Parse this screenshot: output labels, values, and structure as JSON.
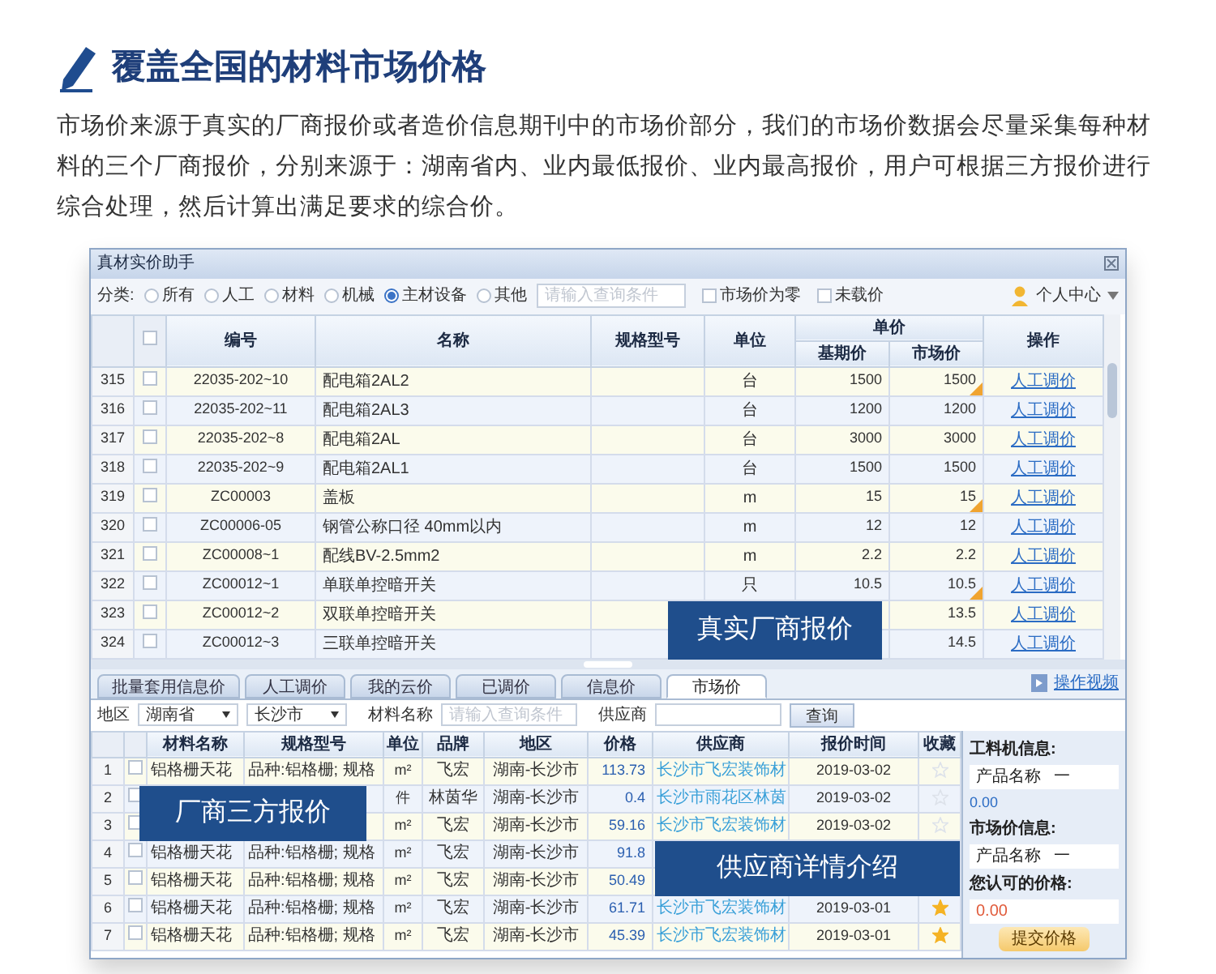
{
  "heading": "覆盖全国的材料市场价格",
  "intro": "市场价来源于真实的厂商报价或者造价信息期刊中的市场价部分，我们的市场价数据会尽量采集每种材料的三个厂商报价，分别来源于：湖南省内、业内最低报价、业内最高报价，用户可根据三方报价进行综合处理，然后计算出满足要求的综合价。",
  "window": {
    "title": "真材实价助手"
  },
  "toolbar": {
    "category_label": "分类:",
    "categories": [
      {
        "label": "所有",
        "selected": false
      },
      {
        "label": "人工",
        "selected": false
      },
      {
        "label": "材料",
        "selected": false
      },
      {
        "label": "机械",
        "selected": false
      },
      {
        "label": "主材设备",
        "selected": true
      },
      {
        "label": "其他",
        "selected": false
      }
    ],
    "search": {
      "placeholder": "请输入查询条件"
    },
    "options": [
      {
        "label": "市场价为零",
        "checked": false
      },
      {
        "label": "未载价",
        "checked": false
      }
    ],
    "user_menu": "个人中心"
  },
  "price_table": {
    "select_all_checked": false,
    "columns": [
      "编号",
      "名称",
      "规格型号",
      "单位"
    ],
    "group": {
      "label": "单价",
      "columns": [
        "基期价",
        "市场价"
      ]
    },
    "action_column": "操作",
    "rows": [
      {
        "index": "315",
        "checked": false,
        "code": "22035-202~10",
        "name": "配电箱2AL2",
        "unit": "台",
        "base": "1500",
        "market": "1500",
        "adjusted": true,
        "action": "人工调价"
      },
      {
        "index": "316",
        "checked": false,
        "code": "22035-202~11",
        "name": "配电箱2AL3",
        "unit": "台",
        "base": "1200",
        "market": "1200",
        "adjusted": false,
        "action": "人工调价"
      },
      {
        "index": "317",
        "checked": false,
        "code": "22035-202~8",
        "name": "配电箱2AL",
        "unit": "台",
        "base": "3000",
        "market": "3000",
        "adjusted": false,
        "action": "人工调价"
      },
      {
        "index": "318",
        "checked": false,
        "code": "22035-202~9",
        "name": "配电箱2AL1",
        "unit": "台",
        "base": "1500",
        "market": "1500",
        "adjusted": false,
        "action": "人工调价"
      },
      {
        "index": "319",
        "checked": false,
        "code": "ZC00003",
        "name": "盖板",
        "unit": "m",
        "base": "15",
        "market": "15",
        "adjusted": true,
        "action": "人工调价"
      },
      {
        "index": "320",
        "checked": false,
        "code": "ZC00006-05",
        "name": "钢管公称口径 40mm以内",
        "unit": "m",
        "base": "12",
        "market": "12",
        "adjusted": false,
        "action": "人工调价"
      },
      {
        "index": "321",
        "checked": false,
        "code": "ZC00008~1",
        "name": "配线BV-2.5mm2",
        "unit": "m",
        "base": "2.2",
        "market": "2.2",
        "adjusted": false,
        "action": "人工调价"
      },
      {
        "index": "322",
        "checked": false,
        "code": "ZC00012~1",
        "name": "单联单控暗开关",
        "unit": "只",
        "base": "10.5",
        "market": "10.5",
        "adjusted": true,
        "action": "人工调价"
      },
      {
        "index": "323",
        "checked": false,
        "code": "ZC00012~2",
        "name": "双联单控暗开关",
        "market": "13.5",
        "adjusted": false,
        "action": "人工调价"
      },
      {
        "index": "324",
        "checked": false,
        "code": "ZC00012~3",
        "name": "三联单控暗开关",
        "market": "14.5",
        "adjusted": false,
        "action": "人工调价"
      }
    ],
    "callout": "真实厂商报价"
  },
  "tabs": [
    {
      "label": "批量套用信息价",
      "selected": false
    },
    {
      "label": "人工调价",
      "selected": false
    },
    {
      "label": "我的云价",
      "selected": false
    },
    {
      "label": "已调价",
      "selected": false
    },
    {
      "label": "信息价",
      "selected": false
    },
    {
      "label": "市场价",
      "selected": true
    }
  ],
  "help_link": "操作视频",
  "filters": {
    "region_label": "地区",
    "province": "湖南省",
    "city": "长沙市",
    "material_label": "材料名称",
    "material_placeholder": "请输入查询条件",
    "supplier_label": "供应商",
    "query_button": "查询"
  },
  "market_table": {
    "columns": [
      "材料名称",
      "规格型号",
      "单位",
      "品牌",
      "地区",
      "价格",
      "供应商",
      "报价时间",
      "收藏"
    ],
    "rows": [
      {
        "index": "1",
        "checked": false,
        "name": "铝格栅天花",
        "spec": "品种:铝格栅; 规格",
        "unit": "m²",
        "brand": "飞宏",
        "region": "湖南-长沙市",
        "price": "113.73",
        "supplier": "长沙市飞宏装饰材",
        "date": "2019-03-02",
        "favorite": false
      },
      {
        "index": "2",
        "checked": false,
        "unit": "件",
        "brand": "林茵华",
        "region": "湖南-长沙市",
        "price": "0.4",
        "supplier": "长沙市雨花区林茵",
        "date": "2019-03-02",
        "favorite": false
      },
      {
        "index": "3",
        "checked": false,
        "unit": "m²",
        "brand": "飞宏",
        "region": "湖南-长沙市",
        "price": "59.16",
        "supplier": "长沙市飞宏装饰材",
        "date": "2019-03-02",
        "favorite": false
      },
      {
        "index": "4",
        "checked": false,
        "name": "铝格栅天花",
        "spec": "品种:铝格栅; 规格",
        "unit": "m²",
        "brand": "飞宏",
        "region": "湖南-长沙市",
        "price": "91.8"
      },
      {
        "index": "5",
        "checked": false,
        "name": "铝格栅天花",
        "spec": "品种:铝格栅; 规格",
        "unit": "m²",
        "brand": "飞宏",
        "region": "湖南-长沙市",
        "price": "50.49"
      },
      {
        "index": "6",
        "checked": false,
        "name": "铝格栅天花",
        "spec": "品种:铝格栅; 规格",
        "unit": "m²",
        "brand": "飞宏",
        "region": "湖南-长沙市",
        "price": "61.71",
        "supplier": "长沙市飞宏装饰材",
        "date": "2019-03-01",
        "favorite": true
      },
      {
        "index": "7",
        "checked": false,
        "name": "铝格栅天花",
        "spec": "品种:铝格栅; 规格",
        "unit": "m²",
        "brand": "飞宏",
        "region": "湖南-长沙市",
        "price": "45.39",
        "supplier": "长沙市飞宏装饰材",
        "date": "2019-03-01",
        "favorite": true
      }
    ],
    "callouts": [
      "厂商三方报价",
      "供应商详情介绍"
    ]
  },
  "side_panel": {
    "material_title": "工料机信息:",
    "product_label": "产品名称",
    "product_value": "一",
    "material_price": "0.00",
    "market_title": "市场价信息:",
    "market_product_label": "产品名称",
    "market_product_value": "一",
    "approved_label": "您认可的价格:",
    "approved_value": "0.00",
    "submit": "提交价格"
  }
}
